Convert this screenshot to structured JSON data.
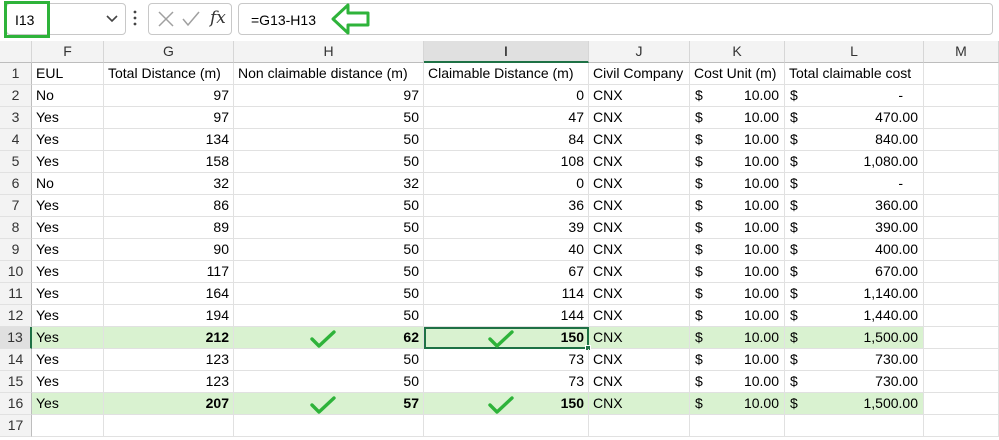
{
  "formula_bar": {
    "name_box": "I13",
    "formula": "=G13-H13",
    "fx_label": "fx"
  },
  "columns": [
    "F",
    "G",
    "H",
    "I",
    "J",
    "K",
    "L",
    "M"
  ],
  "headers": {
    "row_number": "1",
    "F": "EUL",
    "G": "Total Distance (m)",
    "H": "Non claimable distance (m)",
    "I": "Claimable Distance (m)",
    "J": "Civil Company",
    "K": "Cost Unit (m)",
    "L": "Total claimable cost"
  },
  "rows": [
    {
      "n": "2",
      "eul": "No",
      "total": "97",
      "non": "97",
      "claim": "0",
      "company": "CNX",
      "unit": "10.00",
      "cost": "-",
      "highlight": false
    },
    {
      "n": "3",
      "eul": "Yes",
      "total": "97",
      "non": "50",
      "claim": "47",
      "company": "CNX",
      "unit": "10.00",
      "cost": "470.00",
      "highlight": false
    },
    {
      "n": "4",
      "eul": "Yes",
      "total": "134",
      "non": "50",
      "claim": "84",
      "company": "CNX",
      "unit": "10.00",
      "cost": "840.00",
      "highlight": false
    },
    {
      "n": "5",
      "eul": "Yes",
      "total": "158",
      "non": "50",
      "claim": "108",
      "company": "CNX",
      "unit": "10.00",
      "cost": "1,080.00",
      "highlight": false
    },
    {
      "n": "6",
      "eul": "No",
      "total": "32",
      "non": "32",
      "claim": "0",
      "company": "CNX",
      "unit": "10.00",
      "cost": "-",
      "highlight": false
    },
    {
      "n": "7",
      "eul": "Yes",
      "total": "86",
      "non": "50",
      "claim": "36",
      "company": "CNX",
      "unit": "10.00",
      "cost": "360.00",
      "highlight": false
    },
    {
      "n": "8",
      "eul": "Yes",
      "total": "89",
      "non": "50",
      "claim": "39",
      "company": "CNX",
      "unit": "10.00",
      "cost": "390.00",
      "highlight": false
    },
    {
      "n": "9",
      "eul": "Yes",
      "total": "90",
      "non": "50",
      "claim": "40",
      "company": "CNX",
      "unit": "10.00",
      "cost": "400.00",
      "highlight": false
    },
    {
      "n": "10",
      "eul": "Yes",
      "total": "117",
      "non": "50",
      "claim": "67",
      "company": "CNX",
      "unit": "10.00",
      "cost": "670.00",
      "highlight": false
    },
    {
      "n": "11",
      "eul": "Yes",
      "total": "164",
      "non": "50",
      "claim": "114",
      "company": "CNX",
      "unit": "10.00",
      "cost": "1,140.00",
      "highlight": false
    },
    {
      "n": "12",
      "eul": "Yes",
      "total": "194",
      "non": "50",
      "claim": "144",
      "company": "CNX",
      "unit": "10.00",
      "cost": "1,440.00",
      "highlight": false
    },
    {
      "n": "13",
      "eul": "Yes",
      "total": "212",
      "non": "62",
      "claim": "150",
      "company": "CNX",
      "unit": "10.00",
      "cost": "1,500.00",
      "highlight": true
    },
    {
      "n": "14",
      "eul": "Yes",
      "total": "123",
      "non": "50",
      "claim": "73",
      "company": "CNX",
      "unit": "10.00",
      "cost": "730.00",
      "highlight": false
    },
    {
      "n": "15",
      "eul": "Yes",
      "total": "123",
      "non": "50",
      "claim": "73",
      "company": "CNX",
      "unit": "10.00",
      "cost": "730.00",
      "highlight": false
    },
    {
      "n": "16",
      "eul": "Yes",
      "total": "207",
      "non": "57",
      "claim": "150",
      "company": "CNX",
      "unit": "10.00",
      "cost": "1,500.00",
      "highlight": true
    },
    {
      "n": "17",
      "eul": "",
      "total": "",
      "non": "",
      "claim": "",
      "company": "",
      "unit": "",
      "cost": "",
      "highlight": false
    }
  ],
  "currency_symbol": "$",
  "active_cell": {
    "column": "I",
    "row": "13"
  },
  "colors": {
    "annotation_green": "#2eb33a",
    "row_highlight": "#d9f2d0",
    "selection": "#1e7145"
  },
  "icons": {
    "name_box_dropdown": "chevron-down-icon",
    "more": "vertical-dots-icon",
    "cancel": "close-icon",
    "enter": "checkmark-icon",
    "insert_function": "fx-icon",
    "annotation_arrow": "arrow-left-icon",
    "annotation_check": "checkmark-icon"
  }
}
